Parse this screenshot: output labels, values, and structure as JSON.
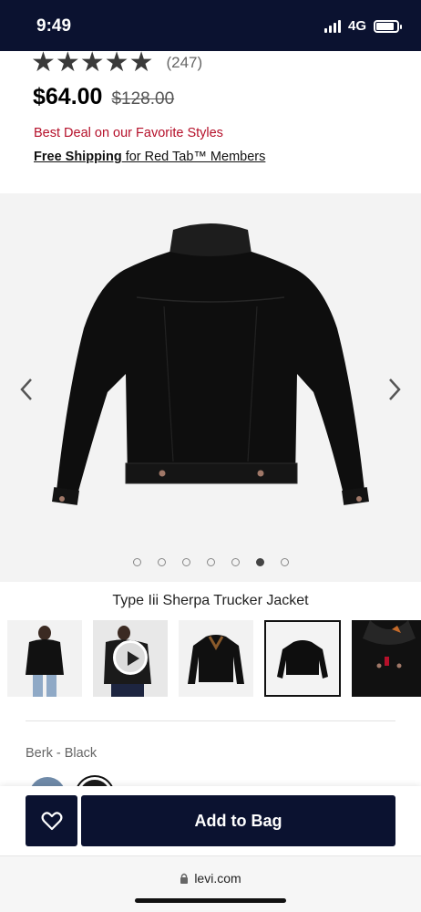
{
  "status_bar": {
    "time": "9:49",
    "network": "4G",
    "battery_level": 0.85
  },
  "product": {
    "rating_stars": "★★★★★",
    "rating_value": 4.5,
    "rating_count": "(247)",
    "price": "$64.00",
    "original_price": "$128.00",
    "deal_text": "Best Deal on our Favorite Styles",
    "shipping_bold": "Free Shipping",
    "shipping_rest": " for Red Tab™ Members",
    "name": "Type Iii Sherpa Trucker Jacket",
    "color_label": "Berk - Black"
  },
  "gallery": {
    "image_count": 7,
    "active_index": 5,
    "prev_icon": "chevron-left-icon",
    "next_icon": "chevron-right-icon"
  },
  "thumbnails": [
    {
      "kind": "model-back"
    },
    {
      "kind": "video"
    },
    {
      "kind": "front"
    },
    {
      "kind": "back",
      "selected": true
    },
    {
      "kind": "detail"
    }
  ],
  "actions": {
    "add_to_bag": "Add to Bag",
    "wishlist_icon": "heart-icon"
  },
  "browser": {
    "url": "levi.com",
    "lock_icon": "lock-icon"
  },
  "colors": {
    "navy": "#0b1230",
    "deal_red": "#b5102a"
  }
}
